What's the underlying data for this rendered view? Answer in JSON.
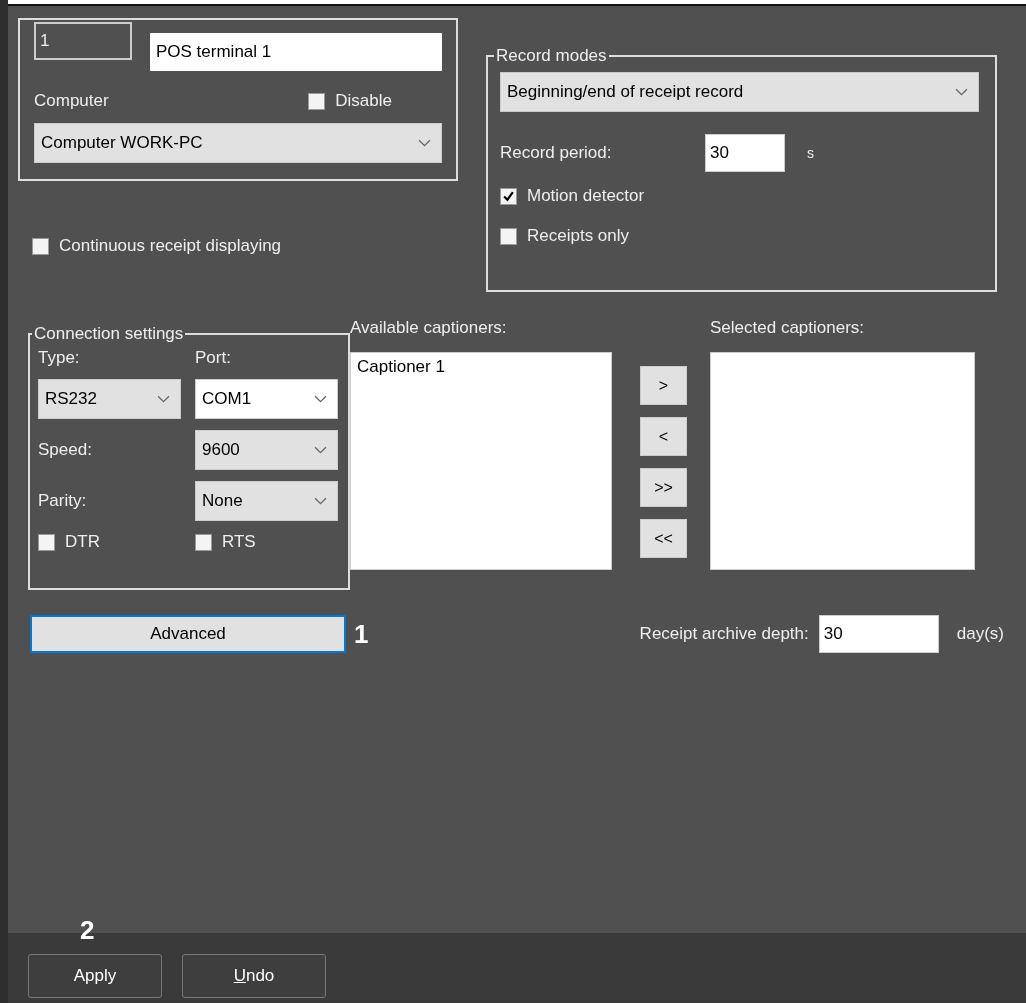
{
  "header_fields": {
    "id": {
      "value": "1",
      "disabled": true
    },
    "name": {
      "value": "POS terminal 1",
      "disabled": false
    }
  },
  "computer": {
    "label": "Computer",
    "disable": {
      "label": "Disable",
      "checked": false
    },
    "dropdown": {
      "value": "Computer WORK-PC",
      "focused": false
    }
  },
  "continuous_receipt": {
    "label": "Continuous receipt displaying",
    "checked": false
  },
  "record_modes": {
    "title": "Record modes",
    "mode": {
      "value": "Beginning/end of receipt record",
      "focused": false
    },
    "period_label": "Record period:",
    "period": "30",
    "period_unit": "s",
    "options": [
      {
        "label": "Motion detector",
        "checked": true
      },
      {
        "label": "Receipts only",
        "checked": false
      }
    ]
  },
  "connection": {
    "title": "Connection settings",
    "type_label": "Type:",
    "port_label": "Port:",
    "type": {
      "value": "RS232",
      "focused": false
    },
    "port": {
      "value": "COM1",
      "focused": true
    },
    "speed_label": "Speed:",
    "speed": {
      "value": "9600",
      "focused": false
    },
    "parity_label": "Parity:",
    "parity": {
      "value": "None",
      "focused": false
    },
    "flags": [
      {
        "label": "DTR",
        "checked": false
      },
      {
        "label": "RTS",
        "checked": false
      }
    ]
  },
  "advanced_button": {
    "label": "Advanced",
    "focused": true
  },
  "advanced_callout": "1",
  "captioners": {
    "available_label": "Available captioners:",
    "available": [
      {
        "label": "Captioner 1",
        "selected": false
      }
    ],
    "selected_label": "Selected captioners:",
    "move_buttons": [
      ">",
      "<",
      ">>",
      "<<"
    ]
  },
  "archive_depth": {
    "label": "Receipt archive depth:",
    "value": "30",
    "unit": "day(s)"
  },
  "apply_callout": "2",
  "footer": {
    "buttons": [
      {
        "label": "Apply",
        "mnemonic": false
      },
      {
        "label": "Undo",
        "mnemonic": true
      }
    ]
  }
}
